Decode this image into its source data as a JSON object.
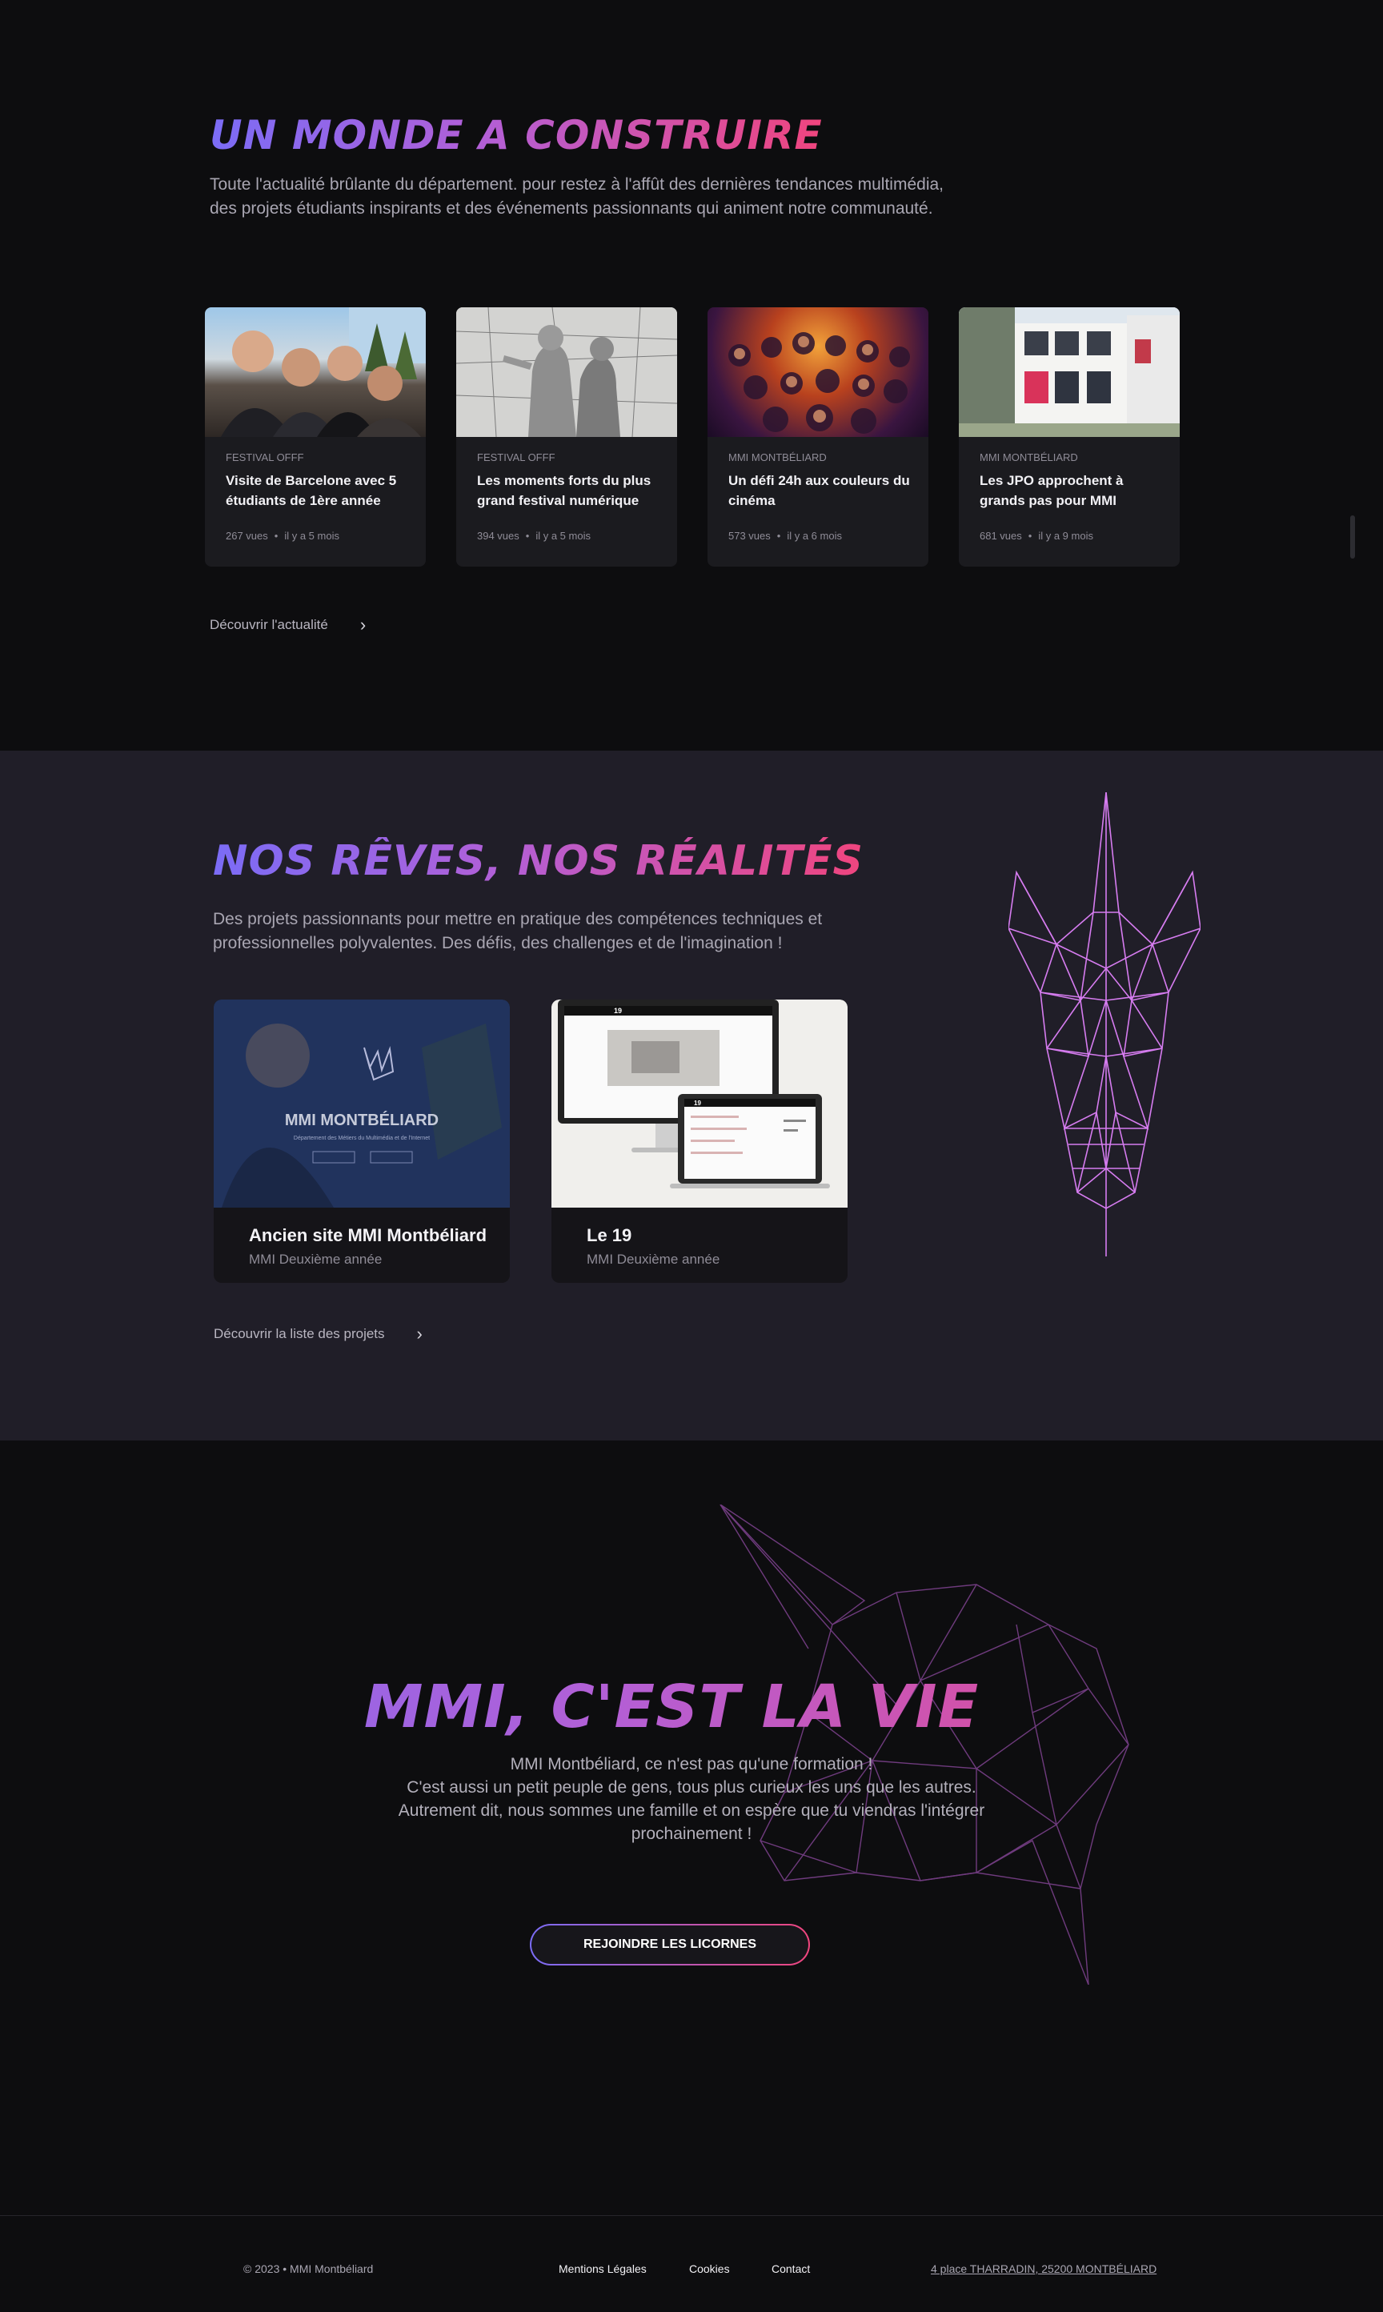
{
  "news": {
    "title": "Un monde a construire",
    "lead": "Toute l'actualité brûlante du département. pour restez à l'affût des dernières tendances multimédia, des projets étudiants inspirants et des événements passionnants qui animent notre communauté.",
    "cards": [
      {
        "category": "FESTIVAL OFFF",
        "title": "Visite de Barcelone avec 5 étudiants de 1ère année",
        "views": "267 vues",
        "age": "il y a 5 mois"
      },
      {
        "category": "FESTIVAL OFFF",
        "title": "Les moments forts du plus grand festival numérique",
        "views": "394 vues",
        "age": "il y a 5 mois"
      },
      {
        "category": "MMI MONTBÉLIARD",
        "title": "Un défi 24h aux couleurs du cinéma",
        "views": "573 vues",
        "age": "il y a 6 mois"
      },
      {
        "category": "MMI MONTBÉLIARD",
        "title": "Les JPO approchent à grands pas pour MMI",
        "views": "681 vues",
        "age": "il y a 9 mois"
      }
    ],
    "more_label": "Découvrir l'actualité",
    "dot": "•"
  },
  "projects": {
    "title": "Nos rêves, nos réalités",
    "lead": "Des projets passionnants pour mettre en pratique des compétences techniques et professionnelles polyvalentes. Des défis, des challenges et de l'imagination !",
    "cards": [
      {
        "title": "Ancien site MMI Montbéliard",
        "subtitle": "MMI Deuxième année",
        "overlay_title": "MMI MONTBÉLIARD",
        "overlay_sub": "Département des Métiers du Multimédia et de l'Internet"
      },
      {
        "title": "Le 19",
        "subtitle": "MMI Deuxième année",
        "badge": "19"
      }
    ],
    "more_label": "Découvrir la liste des projets"
  },
  "life": {
    "title": "MMI, c'est la vie",
    "lines": [
      "MMI Montbéliard, ce n'est pas qu'une formation !",
      "C'est aussi un petit peuple de gens, tous plus curieux les uns que les autres.",
      "Autrement dit, nous sommes une famille et on espère que tu viendras l'intégrer",
      "prochainement !"
    ],
    "button": "Rejoindre les licornes"
  },
  "footer": {
    "copyright": "© 2023  •  MMI Montbéliard",
    "links": [
      "Mentions Légales",
      "Cookies",
      "Contact"
    ],
    "address": "4 place THARRADIN, 25200 MONTBÉLIARD"
  },
  "colors": {
    "accent_start": "#7b6cf6",
    "accent_end": "#f0457e",
    "unicorn": "#d67cf0"
  }
}
